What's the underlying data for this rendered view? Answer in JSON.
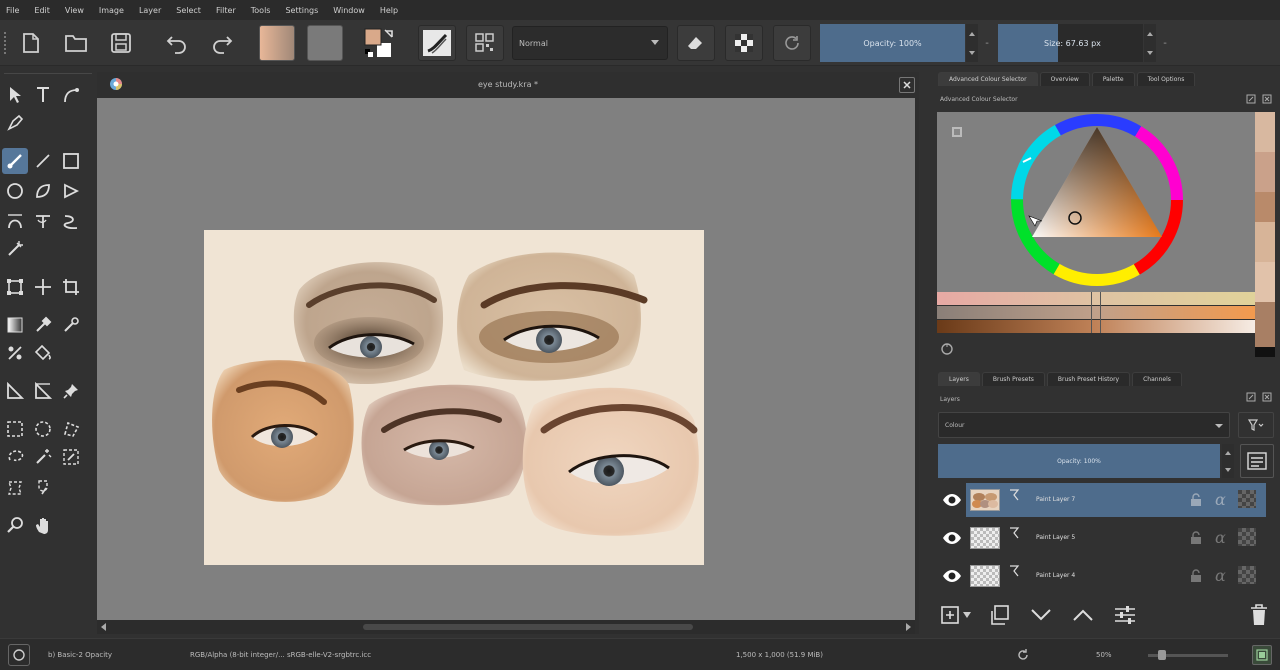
{
  "menu": [
    "File",
    "Edit",
    "View",
    "Image",
    "Layer",
    "Select",
    "Filter",
    "Tools",
    "Settings",
    "Window",
    "Help"
  ],
  "toolbar": {
    "blend_mode": "Normal",
    "opacity_label": "Opacity: 100%",
    "opacity_value": 1.0,
    "size_label": "Size: 67.63 px",
    "size_value": 0.32
  },
  "document": {
    "title": "eye study.kra *"
  },
  "docker": {
    "top_tabs": [
      "Advanced Colour Selector",
      "Overview",
      "Palette",
      "Tool Options"
    ],
    "color_panel_title": "Advanced Colour Selector",
    "bottom_tabs": [
      "Layers",
      "Brush Presets",
      "Brush Preset History",
      "Channels"
    ],
    "layers_panel_title": "Layers",
    "layer_blend": "Colour",
    "layer_opacity": "Opacity: 100%",
    "layers": [
      {
        "name": "Paint Layer 7",
        "selected": true
      },
      {
        "name": "Paint Layer 5",
        "selected": false
      },
      {
        "name": "Paint Layer 4",
        "selected": false
      }
    ]
  },
  "status": {
    "brush": "b) Basic-2 Opacity",
    "color_space": "RGB/Alpha (8-bit integer/... sRGB-elle-V2-srgbtrc.icc",
    "dimensions": "1,500 x 1,000 (51.9 MiB)",
    "zoom": "50%"
  },
  "colors": {
    "accent": "#4e6c8c",
    "paper": "#f0e4d4",
    "canvas_bg": "#808080",
    "fg_color": "#d9a98a",
    "bg_color": "#ffffff"
  }
}
